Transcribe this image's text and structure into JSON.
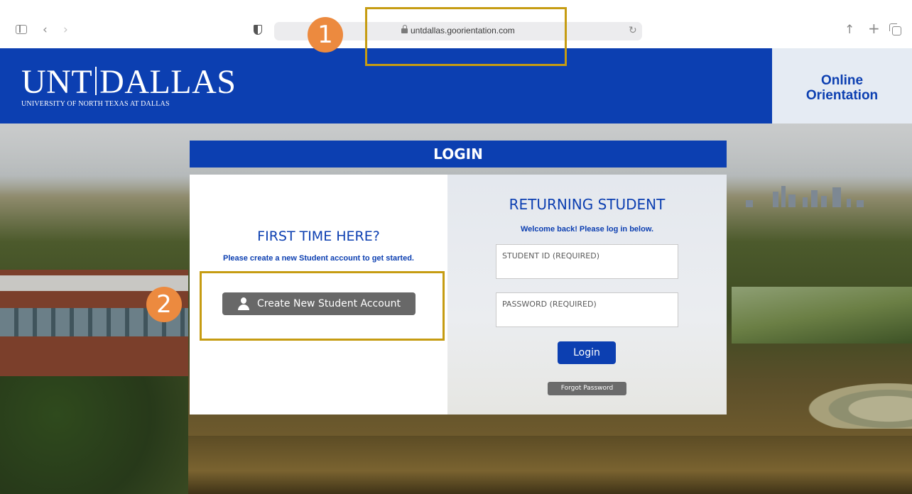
{
  "browser": {
    "url": "untdallas.goorientation.com",
    "icons": {
      "sidebar": "sidebar-icon",
      "back": "chevron-left-icon",
      "forward": "chevron-right-icon",
      "shield": "shield-icon",
      "lock": "lock-icon",
      "reload": "reload-icon",
      "share": "share-icon",
      "new_tab": "plus-icon",
      "tab_overview": "tabs-icon"
    }
  },
  "annotations": {
    "step1": "1",
    "step2": "2",
    "highlight_color": "#c69c12",
    "badge_color": "#ec8a3f"
  },
  "header": {
    "logo_left": "UNT",
    "logo_right": "DALLAS",
    "logo_subtitle": "UNIVERSITY OF NORTH TEXAS AT DALLAS",
    "orientation_line1": "Online",
    "orientation_line2": "Orientation",
    "brand_color": "#0c3fb1"
  },
  "login": {
    "title": "LOGIN",
    "first_time": {
      "heading": "FIRST TIME HERE?",
      "description": "Please create a new Student account to get started.",
      "create_button": "Create New Student Account"
    },
    "returning": {
      "heading": "RETURNING STUDENT",
      "description": "Welcome back! Please log in below.",
      "student_id_placeholder": "STUDENT ID (REQUIRED)",
      "password_placeholder": "PASSWORD (REQUIRED)",
      "login_button": "Login",
      "forgot_button": "Forgot Password"
    }
  }
}
